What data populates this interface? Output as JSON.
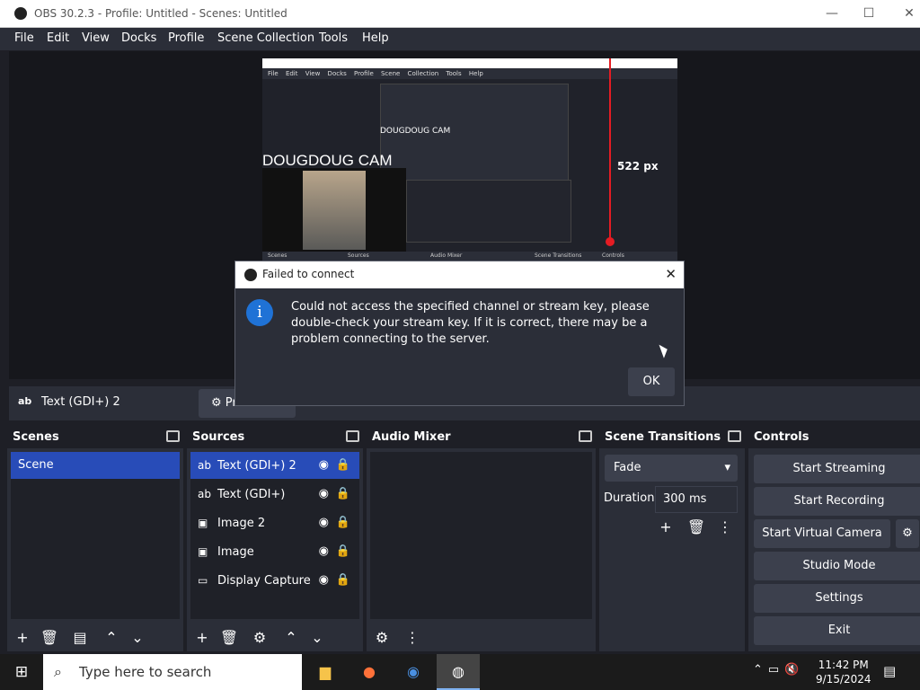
{
  "window": {
    "title": "OBS 30.2.3 - Profile: Untitled - Scenes: Untitled"
  },
  "menu": [
    "File",
    "Edit",
    "View",
    "Docks",
    "Profile",
    "Scene Collection",
    "Tools",
    "Help"
  ],
  "preview": {
    "cam_label": "DOUGDOUG CAM",
    "cam_label_small": "DOUGDOUG CAM",
    "measure_label": "522 px",
    "mini_menu": "File Edit View Docks Profile Scene Collection Tools Help",
    "mini_docks": [
      "Scenes",
      "Sources",
      "Audio Mixer",
      "Scene Transitions",
      "Controls"
    ]
  },
  "propsbar": {
    "ab": "ab",
    "source_name": "Text (GDI+) 2",
    "properties_label": "Pr"
  },
  "docks": {
    "scenes": {
      "title": "Scenes",
      "items": [
        "Scene"
      ]
    },
    "sources": {
      "title": "Sources",
      "items": [
        {
          "icon": "ab",
          "label": "Text (GDI+) 2",
          "selected": true
        },
        {
          "icon": "ab",
          "label": "Text (GDI+)"
        },
        {
          "icon": "img",
          "label": "Image 2"
        },
        {
          "icon": "img",
          "label": "Image"
        },
        {
          "icon": "disp",
          "label": "Display Capture"
        }
      ]
    },
    "audio": {
      "title": "Audio Mixer"
    },
    "transitions": {
      "title": "Scene Transitions",
      "selected": "Fade",
      "duration_label": "Duration",
      "duration_value": "300 ms"
    },
    "controls": {
      "title": "Controls",
      "buttons": [
        "Start Streaming",
        "Start Recording",
        "Start Virtual Camera",
        "Studio Mode",
        "Settings",
        "Exit"
      ]
    }
  },
  "dialog": {
    "title": "Failed to connect",
    "message": "Could not access the specified channel or stream key, please double-check your stream key. If it is correct, there may be a problem connecting to the server.",
    "ok": "OK",
    "icon": "info-icon"
  },
  "taskbar": {
    "search_placeholder": "Type here to search",
    "time": "11:42 PM",
    "date": "9/15/2024"
  }
}
